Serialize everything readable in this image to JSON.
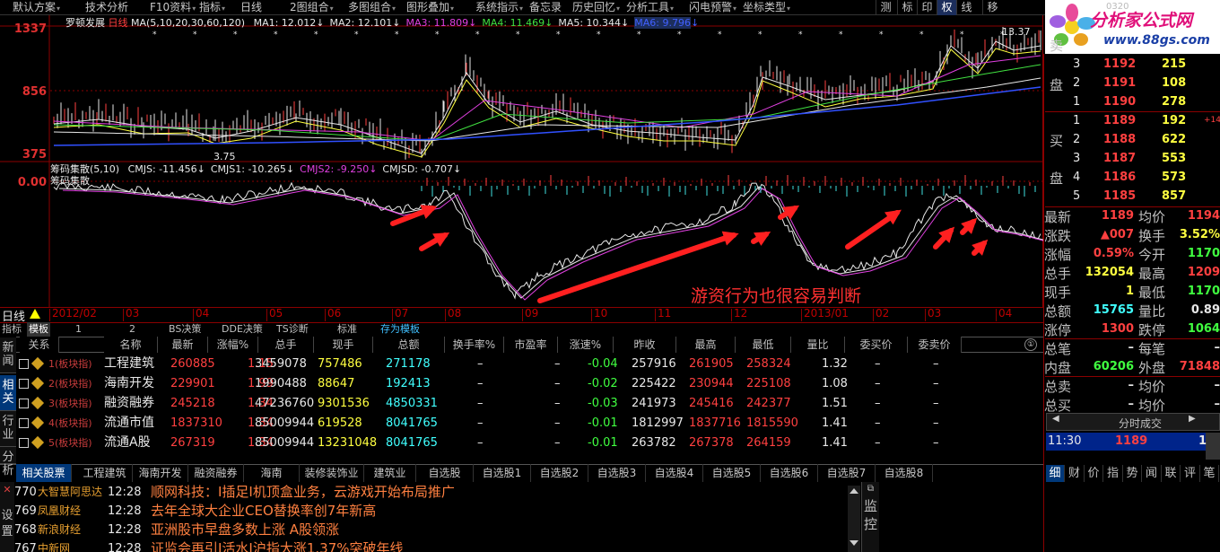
{
  "menu": {
    "items": [
      "默认方案",
      "技术分析",
      "F10资料",
      "指标",
      "日线",
      "2图组合",
      "多图组合",
      "图形叠加",
      "系统指示",
      "备忘录",
      "历史回忆",
      "分析工具",
      "闪电预警",
      "坐标类型"
    ],
    "right_buttons": [
      "测",
      "标",
      "印",
      "权",
      "线",
      "移"
    ]
  },
  "logo": {
    "title": "分析家公式网",
    "url": "www.88gs.com",
    "partial": "0320"
  },
  "main_chart": {
    "stock": "罗顿发展",
    "period": "日线",
    "ma_spec": "MA(5,10,20,30,60,120)",
    "ma": [
      {
        "label": "MA1: 12.012",
        "color": "#e8e8e8"
      },
      {
        "label": "MA2: 12.101",
        "color": "#e8e8e8"
      },
      {
        "label": "MA3: 11.809",
        "color": "#e040e0"
      },
      {
        "label": "MA4: 11.469",
        "color": "#40e040"
      },
      {
        "label": "MA5: 10.344",
        "color": "#e8e8e8"
      },
      {
        "label": "MA6: 9.796",
        "color": "#4060ff"
      }
    ],
    "y_ticks": [
      "1337",
      "856",
      "375"
    ],
    "annotations": [
      "13.37",
      "3.75"
    ]
  },
  "sub_chart": {
    "name": "筹码集散",
    "spec": "(5,10)",
    "title2": "筹码集散",
    "values": [
      {
        "label": "CMJS: -11.456",
        "color": "#e8e8e8"
      },
      {
        "label": "CMJS1: -10.265",
        "color": "#e8e8e8"
      },
      {
        "label": "CMJS2: -9.250",
        "color": "#e040e0"
      },
      {
        "label": "CMJSD: -0.707",
        "color": "#e8e8e8"
      }
    ],
    "y_tick": "0.00",
    "caption": "游资行为也很容易判断"
  },
  "timeline": {
    "period_label": "日线",
    "labels": [
      "2012/02",
      "03",
      "04",
      "05",
      "06",
      "07",
      "08",
      "09",
      "10",
      "11",
      "12",
      "2013/01",
      "02",
      "03",
      "04"
    ]
  },
  "tabrow": {
    "items": [
      "指标",
      "模板",
      "1",
      "2",
      "BS决策",
      "DDE决策",
      "TS诊断",
      "标准",
      "存为模板"
    ]
  },
  "left_side": [
    "新闻",
    "相关",
    "行业",
    "分析"
  ],
  "table": {
    "headers": [
      "关系",
      "名称",
      "最新",
      "涨幅%",
      "总手",
      "现手",
      "总额",
      "换手率%",
      "市盈率",
      "涨速%",
      "昨收",
      "最高",
      "最低",
      "量比",
      "委买价",
      "委卖价"
    ],
    "rows": [
      {
        "rel": "1(板块指)",
        "name": "工程建筑",
        "last": "260885",
        "chg": "1.15",
        "vol": "3459078",
        "cur": "757486",
        "amt": "271178",
        "turn": "–",
        "pe": "–",
        "spd": "-0.04",
        "prev": "257916",
        "high": "261905",
        "low": "258324",
        "vr": "1.32",
        "bid": "–",
        "ask": "–"
      },
      {
        "rel": "2(板块指)",
        "name": "海南开发",
        "last": "229901",
        "chg": "1.99",
        "vol": "1990488",
        "cur": "88647",
        "amt": "192413",
        "turn": "–",
        "pe": "–",
        "spd": "-0.02",
        "prev": "225422",
        "high": "230944",
        "low": "225108",
        "vr": "1.08",
        "bid": "–",
        "ask": "–"
      },
      {
        "rel": "3(板块指)",
        "name": "融资融券",
        "last": "245218",
        "chg": "1.34",
        "vol": "47236760",
        "cur": "9301536",
        "amt": "4850331",
        "turn": "–",
        "pe": "–",
        "spd": "-0.03",
        "prev": "241973",
        "high": "245416",
        "low": "242377",
        "vr": "1.51",
        "bid": "–",
        "ask": "–"
      },
      {
        "rel": "4(板块指)",
        "name": "流通市值",
        "last": "1837310",
        "chg": "1.34",
        "vol": "85009944",
        "cur": "619528",
        "amt": "8041765",
        "turn": "–",
        "pe": "–",
        "spd": "-0.01",
        "prev": "1812997",
        "high": "1837716",
        "low": "1815590",
        "vr": "1.41",
        "bid": "–",
        "ask": "–"
      },
      {
        "rel": "5(板块指)",
        "name": "流通A股",
        "last": "267319",
        "chg": "1.34",
        "vol": "85009944",
        "cur": "13231048",
        "amt": "8041765",
        "turn": "–",
        "pe": "–",
        "spd": "-0.01",
        "prev": "263782",
        "high": "267378",
        "low": "264159",
        "vr": "1.41",
        "bid": "–",
        "ask": "–"
      }
    ]
  },
  "bottom_tabs": [
    "相关股票",
    "工程建筑",
    "海南开发",
    "融资融券",
    "海南",
    "装修装饰业",
    "建筑业",
    "自选股",
    "自选股1",
    "自选股2",
    "自选股3",
    "自选股4",
    "自选股5",
    "自选股6",
    "自选股7",
    "自选股8"
  ],
  "news_side": [
    "设",
    "置"
  ],
  "news": [
    {
      "num": "770",
      "src": "大智慧阿思达",
      "time": "12:28",
      "title": "顺网科技：I插足I机顶盒业务，云游戏开始布局推广"
    },
    {
      "num": "769",
      "src": "凤凰财经",
      "time": "12:28",
      "title": "去年全球大企业CEO替换率创7年新高"
    },
    {
      "num": "768",
      "src": "新浪财经",
      "time": "12:28",
      "title": "亚洲股市早盘多数上涨 A股领涨"
    },
    {
      "num": "767",
      "src": "中新网",
      "time": "12:28",
      "title": "证监会再引I活水I沪指大涨1.37%突破年线"
    }
  ],
  "monitor": [
    "监",
    "控"
  ],
  "order_book": {
    "sell_label": [
      "卖",
      "盘"
    ],
    "buy_label": [
      "买",
      "盘"
    ],
    "sells": [
      {
        "lvl": "3",
        "price": "1192",
        "vol": "215"
      },
      {
        "lvl": "2",
        "price": "1191",
        "vol": "108"
      },
      {
        "lvl": "1",
        "price": "1190",
        "vol": "278"
      }
    ],
    "buys": [
      {
        "lvl": "1",
        "price": "1189",
        "vol": "192",
        "extra": "+14"
      },
      {
        "lvl": "2",
        "price": "1188",
        "vol": "622"
      },
      {
        "lvl": "3",
        "price": "1187",
        "vol": "553"
      },
      {
        "lvl": "4",
        "price": "1186",
        "vol": "573"
      },
      {
        "lvl": "5",
        "price": "1185",
        "vol": "857"
      }
    ]
  },
  "quote": [
    {
      "l1": "最新",
      "v1": "1189",
      "c1": "#ff4040",
      "l2": "均价",
      "v2": "1194",
      "c2": "#ff4040"
    },
    {
      "l1": "涨跌",
      "v1": "▲007",
      "c1": "#ff4040",
      "l2": "换手",
      "v2": "3.52%",
      "c2": "#ffff40"
    },
    {
      "l1": "涨幅",
      "v1": "0.59%",
      "c1": "#ff4040",
      "l2": "今开",
      "v2": "1170",
      "c2": "#40ff40"
    },
    {
      "l1": "总手",
      "v1": "132054",
      "c1": "#ffff40",
      "l2": "最高",
      "v2": "1209",
      "c2": "#ff4040"
    },
    {
      "l1": "现手",
      "v1": "1",
      "c1": "#ffff40",
      "l2": "最低",
      "v2": "1170",
      "c2": "#40ff40"
    },
    {
      "l1": "总额",
      "v1": "15765",
      "c1": "#40ffff",
      "l2": "量比",
      "v2": "0.89",
      "c2": "#e8e8e8"
    },
    {
      "l1": "涨停",
      "v1": "1300",
      "c1": "#ff4040",
      "l2": "跌停",
      "v2": "1064",
      "c2": "#40ff40"
    },
    {
      "l1": "总笔",
      "v1": "–",
      "c1": "#e8e8e8",
      "l2": "每笔",
      "v2": "–",
      "c2": "#e8e8e8"
    },
    {
      "l1": "内盘",
      "v1": "60206",
      "c1": "#40ff40",
      "l2": "外盘",
      "v2": "71848",
      "c2": "#ff4040"
    },
    {
      "l1": "总卖",
      "v1": "–",
      "c1": "#e8e8e8",
      "l2": "均价",
      "v2": "–",
      "c2": "#e8e8e8"
    },
    {
      "l1": "总买",
      "v1": "–",
      "c1": "#e8e8e8",
      "l2": "均价",
      "v2": "–",
      "c2": "#e8e8e8"
    }
  ],
  "ticks": {
    "title": "分时成交",
    "rows": [
      {
        "time": "11:30",
        "price": "1189",
        "vol": "1"
      }
    ]
  },
  "right_tabs": [
    "细",
    "财",
    "价",
    "指",
    "势",
    "闻",
    "联",
    "评",
    "笔"
  ]
}
